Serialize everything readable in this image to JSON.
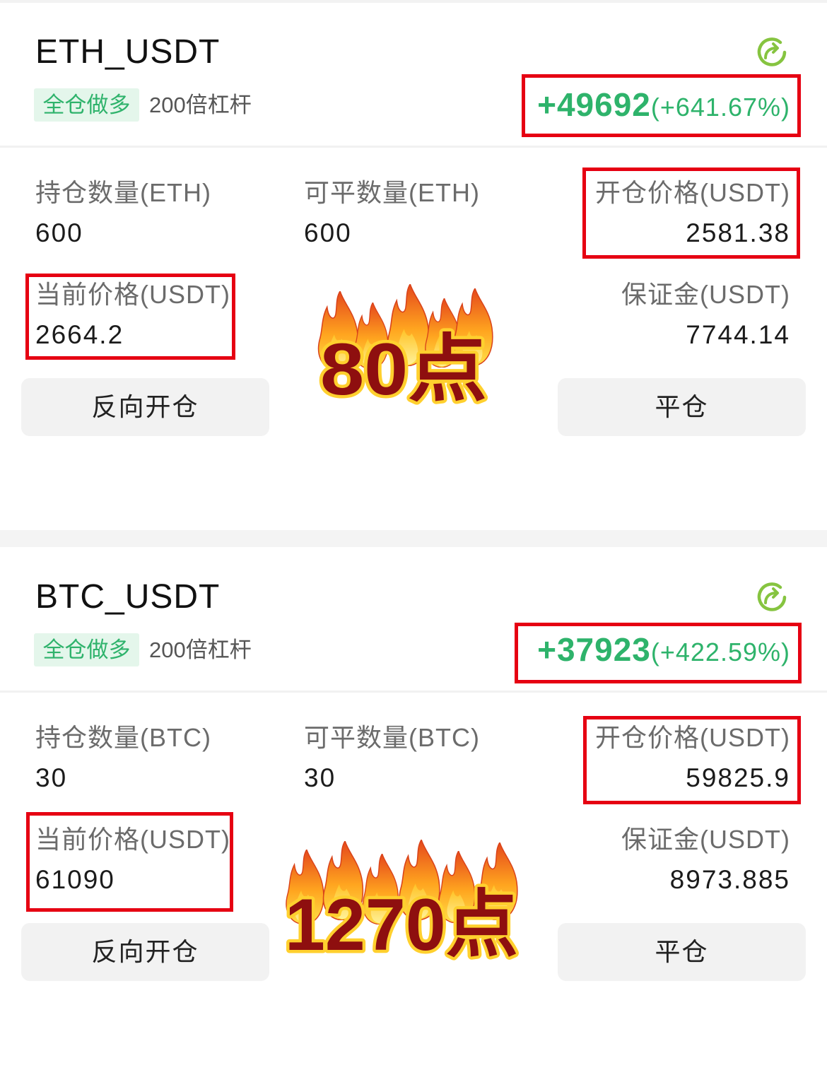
{
  "positions": [
    {
      "symbol": "ETH_USDT",
      "margin_mode": "全仓做多",
      "leverage": "200倍杠杆",
      "pnl_amount": "+49692",
      "pnl_percent": "(+641.67%)",
      "hold_qty_label": "持仓数量(ETH)",
      "hold_qty": "600",
      "closable_qty_label": "可平数量(ETH)",
      "closable_qty": "600",
      "open_price_label": "开仓价格(USDT)",
      "open_price": "2581.38",
      "current_price_label": "当前价格(USDT)",
      "current_price": "2664.2",
      "margin_label": "保证金(USDT)",
      "margin": "7744.14",
      "sticker_text": "80点",
      "reverse_open_label": "反向开仓",
      "close_label": "平仓"
    },
    {
      "symbol": "BTC_USDT",
      "margin_mode": "全仓做多",
      "leverage": "200倍杠杆",
      "pnl_amount": "+37923",
      "pnl_percent": "(+422.59%)",
      "hold_qty_label": "持仓数量(BTC)",
      "hold_qty": "30",
      "closable_qty_label": "可平数量(BTC)",
      "closable_qty": "30",
      "open_price_label": "开仓价格(USDT)",
      "open_price": "59825.9",
      "current_price_label": "当前价格(USDT)",
      "current_price": "61090",
      "margin_label": "保证金(USDT)",
      "margin": "8973.885",
      "sticker_text": "1270点",
      "reverse_open_label": "反向开仓",
      "close_label": "平仓"
    }
  ],
  "icons": {
    "refresh": "refresh-icon",
    "sticker": "fire-icon"
  },
  "colors": {
    "profit_green": "#2eb36b",
    "badge_text": "#2fb36c",
    "badge_bg": "#e4f6eb",
    "refresh_green": "#86c440",
    "highlight_red": "#e60012",
    "sticker_text": "#8e0f0f",
    "sticker_outline": "#ffd02e",
    "button_bg": "#f2f2f2"
  }
}
